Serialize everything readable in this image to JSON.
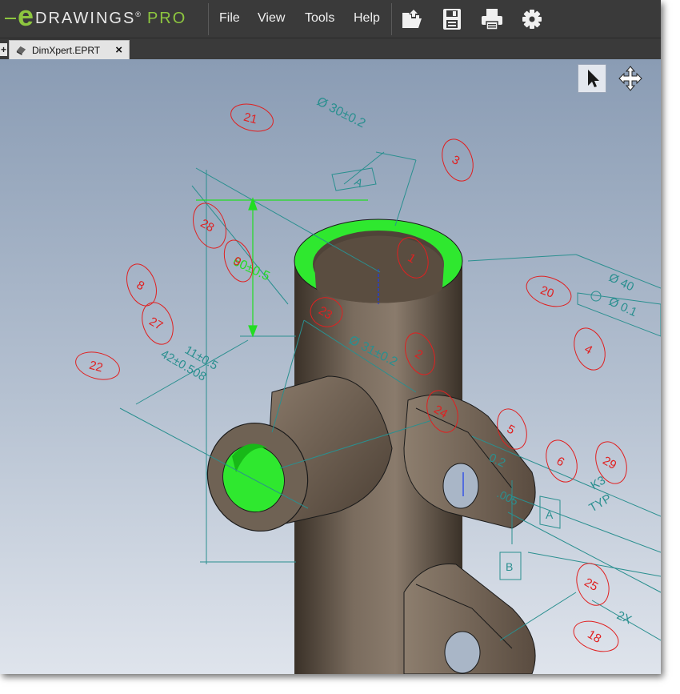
{
  "app": {
    "logo_e": "e",
    "logo_text": "DRAWINGS",
    "logo_reg": "®",
    "logo_pro": "PRO"
  },
  "menu": {
    "file": "File",
    "view": "View",
    "tools": "Tools",
    "help": "Help"
  },
  "toolbar": {
    "icons": [
      "open-icon",
      "save-icon",
      "print-icon",
      "settings-icon"
    ]
  },
  "tabs": [
    {
      "label": "DimXpert.EPRT",
      "close": "×",
      "new_tab": "+"
    }
  ],
  "viewport": {
    "tools": [
      "select-arrow-icon",
      "pan-icon"
    ]
  },
  "annotations": {
    "balloons": [
      "21",
      "3",
      "28",
      "9",
      "8",
      "27",
      "20",
      "1",
      "22",
      "23",
      "2",
      "4",
      "24",
      "5",
      "6",
      "29",
      "25",
      "18"
    ],
    "dim_top_dia": "Ø 30±0.2",
    "datum_a": "A",
    "datum_b": "B",
    "dim_height": "60±0.5",
    "dim_dia_31": "Ø 31±0.2",
    "dim_42": "42±0.508",
    "dim_11": "11±0.5",
    "dim_40": "Ø 40",
    "gtol_01": "Ø 0.1",
    "gtol_ref": "0.2",
    "gtol_005": ".005",
    "gtol_a": "A",
    "k3": "K3",
    "typ": "TYP",
    "two_x": "2X"
  },
  "colors": {
    "menubar": "#3a3a3a",
    "accent_green": "#8dc63f",
    "selection_green": "#22ee22",
    "balloon_red": "#e02020",
    "dimension_teal": "#2a8f8f"
  }
}
